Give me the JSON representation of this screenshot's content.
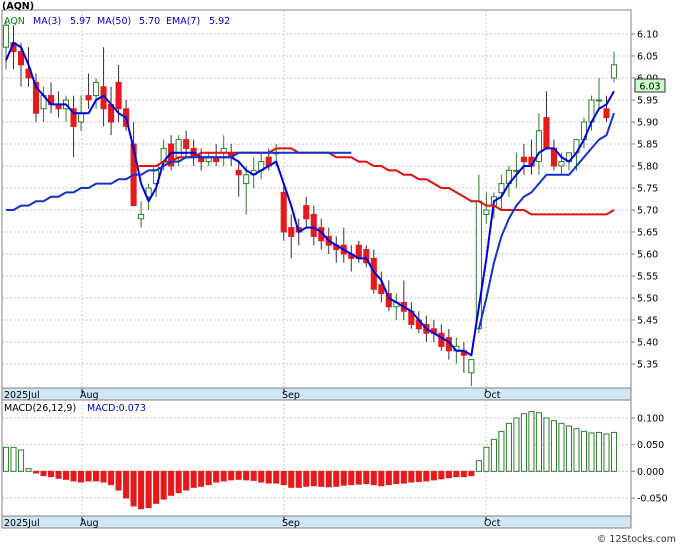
{
  "title": "(AQN)",
  "watermark": "© 12Stocks.com",
  "legend": [
    {
      "label": "AQN",
      "color": "#008000"
    },
    {
      "label": "MA(3)",
      "color": "#0000cc"
    },
    {
      "label": "5.97",
      "color": "#0000cc"
    },
    {
      "label": "MA(50)",
      "color": "#0000cc"
    },
    {
      "label": "5.70",
      "color": "#0000cc"
    },
    {
      "label": "EMA(7)",
      "color": "#0000cc"
    },
    {
      "label": "5.92",
      "color": "#0000cc"
    }
  ],
  "price_badge": "6.03",
  "macd_label": "MACD(26,12,9)",
  "macd_value": "MACD:0.073",
  "colors": {
    "up": "#2e7d2e",
    "down": "#e41a1c",
    "ma3": "#0000dd",
    "ma50": "#dd1111",
    "ema7": "#1133cc",
    "badge_bg": "#ccffcc",
    "axis_band": "#cfe6f3"
  },
  "chart_data": [
    {
      "type": "candlestick",
      "x_labels": [
        "2025Jul",
        "Aug",
        "Sep",
        "Oct"
      ],
      "ylim": [
        5.3,
        6.15
      ],
      "yticks": [
        "6.10",
        "6.05",
        "6.00",
        "5.95",
        "5.90",
        "5.85",
        "5.80",
        "5.75",
        "5.70",
        "5.65",
        "5.60",
        "5.55",
        "5.50",
        "5.45",
        "5.40",
        "5.35"
      ],
      "candles": [
        [
          6.07,
          6.13,
          6.02,
          6.12
        ],
        [
          6.08,
          6.12,
          6.02,
          6.06
        ],
        [
          6.06,
          6.08,
          5.98,
          6.03
        ],
        [
          6.02,
          6.07,
          5.98,
          6.0
        ],
        [
          5.99,
          6.01,
          5.9,
          5.92
        ],
        [
          5.93,
          5.98,
          5.9,
          5.96
        ],
        [
          5.96,
          5.99,
          5.92,
          5.94
        ],
        [
          5.94,
          5.97,
          5.91,
          5.93
        ],
        [
          5.93,
          5.96,
          5.9,
          5.95
        ],
        [
          5.93,
          5.96,
          5.82,
          5.89
        ],
        [
          5.9,
          5.96,
          5.88,
          5.92
        ],
        [
          5.96,
          6.01,
          5.93,
          5.95
        ],
        [
          5.96,
          6.0,
          5.93,
          5.99
        ],
        [
          5.98,
          6.07,
          5.89,
          5.93
        ],
        [
          5.94,
          5.98,
          5.87,
          5.9
        ],
        [
          5.99,
          6.03,
          5.9,
          5.93
        ],
        [
          5.93,
          5.95,
          5.88,
          5.89
        ],
        [
          5.85,
          5.9,
          5.78,
          5.71
        ],
        [
          5.68,
          5.72,
          5.66,
          5.69
        ],
        [
          5.73,
          5.76,
          5.7,
          5.75
        ],
        [
          5.76,
          5.8,
          5.73,
          5.8
        ],
        [
          5.81,
          5.86,
          5.79,
          5.84
        ],
        [
          5.85,
          5.87,
          5.79,
          5.8
        ],
        [
          5.82,
          5.87,
          5.8,
          5.86
        ],
        [
          5.86,
          5.88,
          5.82,
          5.84
        ],
        [
          5.84,
          5.86,
          5.8,
          5.82
        ],
        [
          5.82,
          5.84,
          5.79,
          5.81
        ],
        [
          5.81,
          5.83,
          5.8,
          5.82
        ],
        [
          5.82,
          5.85,
          5.8,
          5.81
        ],
        [
          5.83,
          5.87,
          5.8,
          5.84
        ],
        [
          5.83,
          5.85,
          5.8,
          5.82
        ],
        [
          5.79,
          5.81,
          5.73,
          5.78
        ],
        [
          5.76,
          5.8,
          5.69,
          5.78
        ],
        [
          5.78,
          5.82,
          5.75,
          5.79
        ],
        [
          5.79,
          5.83,
          5.77,
          5.81
        ],
        [
          5.82,
          5.84,
          5.79,
          5.8
        ],
        [
          5.83,
          5.85,
          5.8,
          5.83
        ],
        [
          5.74,
          5.76,
          5.63,
          5.65
        ],
        [
          5.66,
          5.69,
          5.59,
          5.64
        ],
        [
          5.66,
          5.68,
          5.62,
          5.65
        ],
        [
          5.71,
          5.73,
          5.66,
          5.68
        ],
        [
          5.69,
          5.71,
          5.62,
          5.64
        ],
        [
          5.66,
          5.68,
          5.61,
          5.63
        ],
        [
          5.64,
          5.66,
          5.6,
          5.62
        ],
        [
          5.62,
          5.64,
          5.58,
          5.61
        ],
        [
          5.62,
          5.66,
          5.58,
          5.6
        ],
        [
          5.6,
          5.62,
          5.56,
          5.59
        ],
        [
          5.62,
          5.63,
          5.58,
          5.59
        ],
        [
          5.61,
          5.62,
          5.57,
          5.58
        ],
        [
          5.59,
          5.61,
          5.51,
          5.52
        ],
        [
          5.53,
          5.56,
          5.49,
          5.51
        ],
        [
          5.51,
          5.54,
          5.47,
          5.48
        ],
        [
          5.48,
          5.51,
          5.45,
          5.49
        ],
        [
          5.49,
          5.54,
          5.45,
          5.47
        ],
        [
          5.47,
          5.49,
          5.43,
          5.44
        ],
        [
          5.45,
          5.47,
          5.42,
          5.43
        ],
        [
          5.44,
          5.46,
          5.4,
          5.42
        ],
        [
          5.43,
          5.45,
          5.4,
          5.42
        ],
        [
          5.42,
          5.44,
          5.38,
          5.39
        ],
        [
          5.41,
          5.43,
          5.36,
          5.38
        ],
        [
          5.38,
          5.41,
          5.35,
          5.39
        ],
        [
          5.38,
          5.4,
          5.33,
          5.37
        ],
        [
          5.33,
          5.36,
          5.3,
          5.36
        ],
        [
          5.43,
          5.78,
          5.42,
          5.72
        ],
        [
          5.69,
          5.74,
          5.67,
          5.7
        ],
        [
          5.71,
          5.74,
          5.68,
          5.73
        ],
        [
          5.74,
          5.78,
          5.7,
          5.76
        ],
        [
          5.76,
          5.8,
          5.73,
          5.79
        ],
        [
          5.79,
          5.83,
          5.75,
          5.79
        ],
        [
          5.82,
          5.85,
          5.78,
          5.81
        ],
        [
          5.82,
          5.86,
          5.78,
          5.8
        ],
        [
          5.81,
          5.92,
          5.78,
          5.88
        ],
        [
          5.91,
          5.97,
          5.84,
          5.84
        ],
        [
          5.84,
          5.86,
          5.79,
          5.8
        ],
        [
          5.8,
          5.83,
          5.78,
          5.81
        ],
        [
          5.81,
          5.83,
          5.79,
          5.83
        ],
        [
          5.83,
          5.86,
          5.79,
          5.86
        ],
        [
          5.86,
          5.91,
          5.84,
          5.9
        ],
        [
          5.9,
          5.96,
          5.88,
          5.95
        ],
        [
          5.95,
          6.0,
          5.93,
          5.95
        ],
        [
          5.93,
          5.96,
          5.9,
          5.91
        ],
        [
          6.0,
          6.06,
          5.99,
          6.03
        ]
      ],
      "series": [
        {
          "name": "MA(3)",
          "color": "#0000dd",
          "values": [
            6.04,
            6.08,
            6.07,
            6.03,
            5.98,
            5.96,
            5.94,
            5.94,
            5.94,
            5.92,
            5.92,
            5.92,
            5.95,
            5.96,
            5.94,
            5.92,
            5.91,
            5.84,
            5.76,
            5.72,
            5.75,
            5.81,
            5.83,
            5.83,
            5.83,
            5.83,
            5.82,
            5.82,
            5.82,
            5.82,
            5.82,
            5.81,
            5.79,
            5.78,
            5.79,
            5.8,
            5.81,
            5.76,
            5.71,
            5.65,
            5.66,
            5.66,
            5.65,
            5.63,
            5.62,
            5.61,
            5.6,
            5.59,
            5.59,
            5.56,
            5.54,
            5.5,
            5.49,
            5.48,
            5.47,
            5.45,
            5.43,
            5.42,
            5.41,
            5.4,
            5.38,
            5.38,
            5.37,
            5.48,
            5.59,
            5.72,
            5.73,
            5.76,
            5.78,
            5.8,
            5.8,
            5.83,
            5.84,
            5.84,
            5.82,
            5.81,
            5.83,
            5.86,
            5.9,
            5.93,
            5.94,
            5.97
          ]
        },
        {
          "name": "MA(50)",
          "color": "#dd1111",
          "values": [
            null,
            null,
            null,
            null,
            null,
            null,
            null,
            null,
            null,
            null,
            null,
            null,
            null,
            null,
            null,
            null,
            null,
            5.8,
            5.8,
            5.8,
            5.8,
            5.81,
            5.81,
            5.82,
            5.82,
            5.82,
            5.83,
            5.83,
            5.83,
            5.83,
            5.83,
            5.83,
            5.83,
            5.83,
            5.83,
            5.83,
            5.84,
            5.84,
            5.84,
            5.83,
            5.83,
            5.83,
            5.83,
            5.83,
            5.82,
            5.82,
            5.82,
            5.81,
            5.81,
            5.8,
            5.8,
            5.79,
            5.79,
            5.78,
            5.78,
            5.77,
            5.77,
            5.76,
            5.75,
            5.75,
            5.74,
            5.73,
            5.72,
            5.72,
            5.71,
            5.71,
            5.7,
            5.7,
            5.7,
            5.7,
            5.69,
            5.69,
            5.69,
            5.69,
            5.69,
            5.69,
            5.69,
            5.69,
            5.69,
            5.69,
            5.69,
            5.7
          ]
        },
        {
          "name": "EMA(7)",
          "color": "#1133cc",
          "values": [
            null,
            null,
            null,
            null,
            null,
            null,
            null,
            null,
            null,
            null,
            null,
            null,
            null,
            null,
            null,
            null,
            null,
            null,
            null,
            null,
            null,
            null,
            null,
            null,
            null,
            null,
            null,
            null,
            null,
            null,
            null,
            null,
            null,
            null,
            null,
            null,
            null,
            null,
            null,
            null,
            null,
            null,
            null,
            null,
            null,
            null,
            null,
            null,
            null,
            null,
            null,
            null,
            null,
            null,
            null,
            null,
            null,
            null,
            null,
            null,
            null,
            null,
            null,
            5.43,
            5.5,
            5.58,
            5.64,
            5.68,
            5.71,
            5.73,
            5.74,
            5.76,
            5.78,
            5.78,
            5.78,
            5.78,
            5.8,
            5.82,
            5.84,
            5.86,
            5.87,
            5.92
          ]
        },
        {
          "name": "MA(50)-early",
          "color": "#1133cc",
          "values": [
            5.7,
            5.7,
            5.71,
            5.71,
            5.72,
            5.72,
            5.73,
            5.73,
            5.74,
            5.74,
            5.75,
            5.75,
            5.76,
            5.76,
            5.76,
            5.77,
            5.77,
            5.78,
            5.78,
            5.79,
            5.79,
            5.8,
            5.81,
            5.81,
            5.82,
            5.82,
            5.82,
            5.82,
            5.82,
            5.82,
            5.82,
            5.83,
            5.83,
            5.83,
            5.83,
            5.83,
            5.83,
            5.83,
            5.83,
            5.83,
            5.83,
            5.83,
            5.83,
            5.83,
            5.83,
            5.83,
            5.83,
            null
          ]
        }
      ],
      "macd": {
        "ylim": [
          -0.08,
          0.13
        ],
        "yticks": [
          "0.100",
          "0.050",
          "0.000",
          "-0.050"
        ],
        "values": [
          0.045,
          0.045,
          0.04,
          0.005,
          -0.003,
          -0.008,
          -0.01,
          -0.013,
          -0.015,
          -0.018,
          -0.02,
          -0.018,
          -0.018,
          -0.02,
          -0.025,
          -0.035,
          -0.05,
          -0.065,
          -0.07,
          -0.068,
          -0.06,
          -0.052,
          -0.045,
          -0.04,
          -0.035,
          -0.03,
          -0.028,
          -0.025,
          -0.02,
          -0.018,
          -0.016,
          -0.015,
          -0.016,
          -0.017,
          -0.02,
          -0.022,
          -0.022,
          -0.025,
          -0.03,
          -0.03,
          -0.028,
          -0.027,
          -0.028,
          -0.029,
          -0.028,
          -0.026,
          -0.025,
          -0.024,
          -0.023,
          -0.025,
          -0.027,
          -0.025,
          -0.023,
          -0.022,
          -0.02,
          -0.019,
          -0.018,
          -0.016,
          -0.014,
          -0.012,
          -0.01,
          -0.01,
          -0.008,
          0.02,
          0.045,
          0.06,
          0.075,
          0.09,
          0.1,
          0.108,
          0.112,
          0.11,
          0.1,
          0.095,
          0.09,
          0.085,
          0.08,
          0.075,
          0.072,
          0.073,
          0.07,
          0.073
        ]
      }
    }
  ]
}
